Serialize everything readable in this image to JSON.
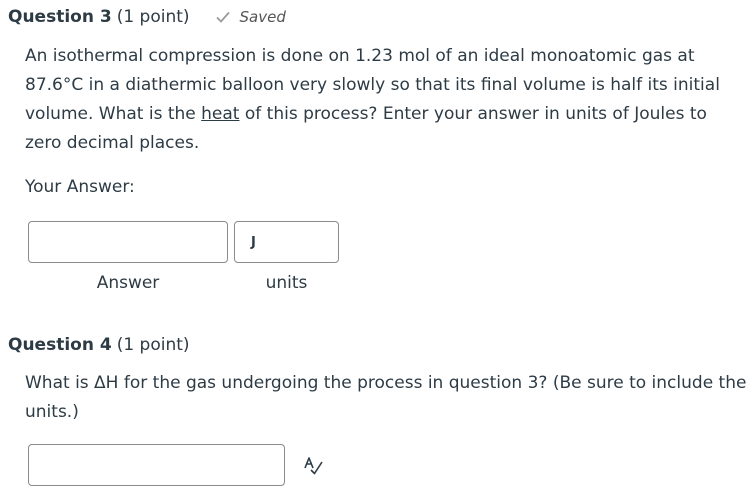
{
  "question3": {
    "title": "Question 3",
    "points": "(1 point)",
    "saved_label": "Saved",
    "body_before_link": "An isothermal compression is done on 1.23 mol of an ideal monoatomic gas at 87.6°C in a diathermic balloon very slowly so that its final volume is half its initial volume.  What is the ",
    "body_link": "heat",
    "body_after_link": " of this process?  Enter your answer in units of Joules to zero decimal places.",
    "your_answer_label": "Your Answer:",
    "answer_value": "",
    "units_value": "J",
    "answer_sublabel": "Answer",
    "units_sublabel": "units"
  },
  "question4": {
    "title": "Question 4",
    "points": "(1 point)",
    "body": "What is ΔH for the gas undergoing the process in question 3? (Be sure to include the units.)",
    "answer_value": ""
  },
  "icons": {
    "saved": "checkmark-icon",
    "spellcheck": "spellcheck-icon"
  },
  "colors": {
    "text": "#2d3b45",
    "check": "#8b8b8b",
    "input_border": "#8b8b8b"
  }
}
